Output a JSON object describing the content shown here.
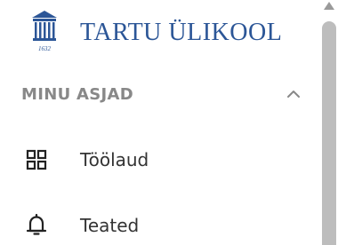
{
  "brand": {
    "name": "TARTU ÜLIKOOL",
    "year": "1632",
    "color": "#2c5697"
  },
  "section": {
    "title": "MINU ASJAD",
    "chevron_icon": "chevron-up-icon"
  },
  "nav": {
    "items": [
      {
        "label": "Töölaud",
        "icon": "dashboard-grid-icon"
      },
      {
        "label": "Teated",
        "icon": "bell-icon"
      }
    ]
  }
}
